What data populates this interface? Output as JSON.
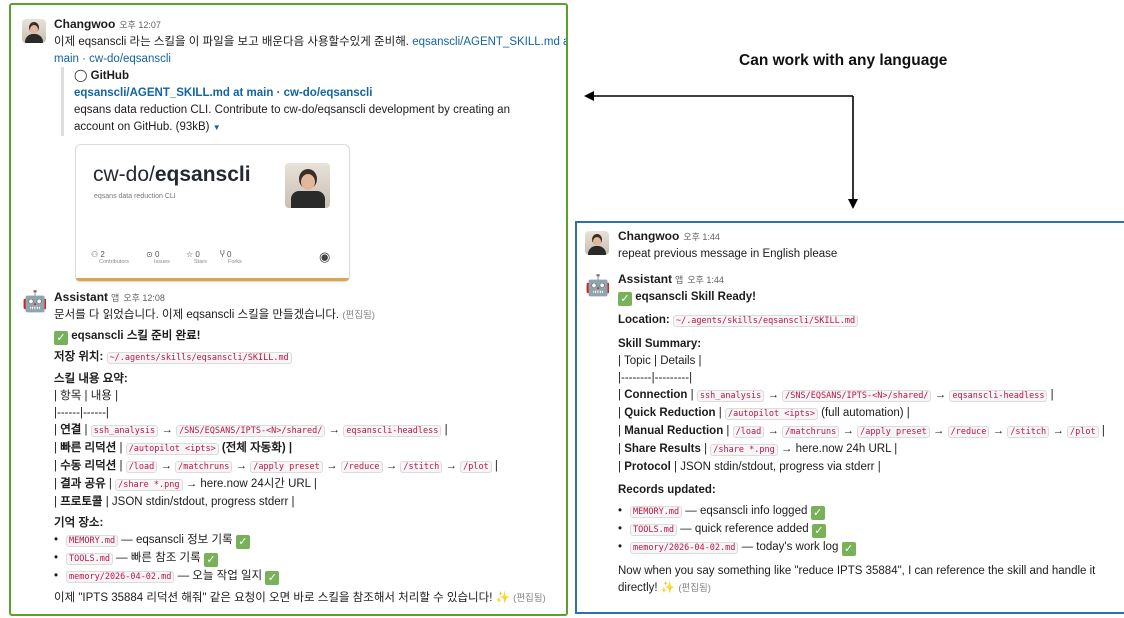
{
  "annotation": {
    "label": "Can work with any language"
  },
  "left": {
    "user_msg": {
      "name": "Changwoo",
      "time": "오후 12:07",
      "text": "이제 eqsanscli 라는 스킬을 이 파일을 보고 배운다음 사용할수있게 준비해.",
      "link_part1": "eqsanscli/AGENT_SKILL.md at",
      "link_part2": "main · cw-do/eqsanscli",
      "unfurl": {
        "site": "GitHub",
        "title": "eqsanscli/AGENT_SKILL.md at main · cw-do/eqsanscli",
        "desc1": "eqsans data reduction CLI. Contribute to cw-do/eqsanscli development by creating an",
        "desc2": "account on GitHub. (93kB)",
        "card": {
          "repo_owner": "cw-do/",
          "repo_name": "eqsanscli",
          "repo_desc": "eqsans data reduction CLI",
          "stats": [
            {
              "icon": "contributors-icon",
              "glyph": "⚇",
              "value": "2",
              "label": "Contributors"
            },
            {
              "icon": "issues-icon",
              "glyph": "⊙",
              "value": "0",
              "label": "Issues"
            },
            {
              "icon": "star-icon",
              "glyph": "☆",
              "value": "0",
              "label": "Stars"
            },
            {
              "icon": "fork-icon",
              "glyph": "Ⴤ",
              "value": "0",
              "label": "Forks"
            }
          ]
        }
      }
    },
    "bot_msg": {
      "name": "Assistant",
      "badge": "앱",
      "time": "오후 12:08",
      "intro": "문서를 다 읽었습니다. 이제 eqsanscli 스킬을 만들겠습니다.",
      "edited": "(편집됨)",
      "ready": "eqsanscli 스킬 준비 완료!",
      "location_label": "저장 위치:",
      "location_path": "~/.agents/skills/eqsanscli/SKILL.md",
      "summary_label": "스킬 내용 요약:",
      "table_header": "| 항목 | 내용 |",
      "table_sep": "|------|------|",
      "rows": {
        "conn_label": "연결",
        "conn_code1": "ssh_analysis",
        "conn_code2": "/SNS/EQSANS/IPTS-<N>/shared/",
        "conn_code3": "eqsanscli-headless",
        "quick_label": "빠른 리덕션",
        "quick_code": "/autopilot <ipts>",
        "quick_note": "(전체 자동화) |",
        "manual_label": "수동 리덕션",
        "manual_codes": [
          "/load",
          "/matchruns",
          "/apply preset",
          "/reduce",
          "/stitch",
          "/plot"
        ],
        "share_label": "결과 공유",
        "share_code": "/share *.png",
        "share_note": "→ here.now 24시간 URL |",
        "proto_label": "프로토콜",
        "proto_note": "| JSON stdin/stdout, progress stderr |"
      },
      "memory_label": "기억 장소:",
      "memory": [
        {
          "code": "MEMORY.md",
          "text": "— eqsanscli 정보 기록"
        },
        {
          "code": "TOOLS.md",
          "text": "— 빠른 참조 기록"
        },
        {
          "code": "memory/2026-04-02.md",
          "text": "— 오늘 작업 일지"
        }
      ],
      "closing": "이제 \"IPTS 35884 리덕션 해줘\" 같은 요청이 오면 바로 스킬을 참조해서 처리할 수 있습니다!"
    }
  },
  "right": {
    "user_msg": {
      "name": "Changwoo",
      "time": "오후 1:44",
      "text": "repeat previous message in English please"
    },
    "bot_msg": {
      "name": "Assistant",
      "badge": "앱",
      "time": "오후 1:44",
      "ready": "eqsanscli Skill Ready!",
      "location_label": "Location:",
      "location_path": "~/.agents/skills/eqsanscli/SKILL.md",
      "summary_label": "Skill Summary:",
      "table_header": "| Topic | Details |",
      "table_sep": "|--------|---------|",
      "rows": {
        "conn_label": "Connection",
        "conn_code1": "ssh_analysis",
        "conn_code2": "/SNS/EQSANS/IPTS-<N>/shared/",
        "conn_code3": "eqsanscli-headless",
        "quick_label": "Quick Reduction",
        "quick_code": "/autopilot <ipts>",
        "quick_note": "(full automation) |",
        "manual_label": "Manual Reduction",
        "manual_codes": [
          "/load",
          "/matchruns",
          "/apply preset",
          "/reduce",
          "/stitch",
          "/plot"
        ],
        "share_label": "Share Results",
        "share_code": "/share *.png",
        "share_note": "→ here.now 24h URL |",
        "proto_label": "Protocol",
        "proto_note": "| JSON stdin/stdout, progress via stderr |"
      },
      "records_label": "Records updated:",
      "records": [
        {
          "code": "MEMORY.md",
          "text": "— eqsanscli info logged"
        },
        {
          "code": "TOOLS.md",
          "text": "— quick reference added"
        },
        {
          "code": "memory/2026-04-02.md",
          "text": "— today's work log"
        }
      ],
      "closing1": "Now when you say something like \"reduce IPTS 35884\", I can reference the skill and handle it",
      "closing2": "directly!",
      "edited": "(편집됨)"
    }
  },
  "colors": {
    "left_border": "#5aa02c",
    "right_border": "#2f6fb0",
    "link": "#1264a3",
    "code": "#c01343",
    "check": "#78b159"
  }
}
